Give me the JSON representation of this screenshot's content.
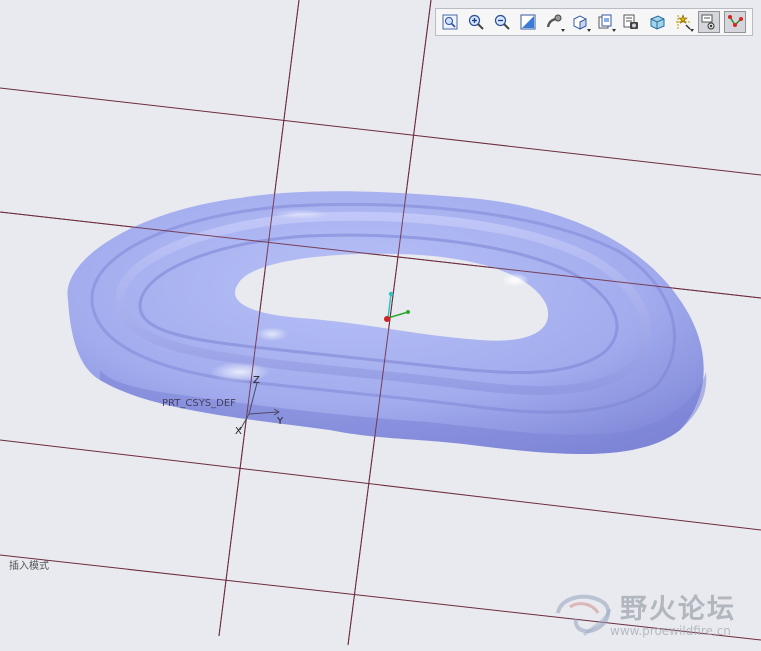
{
  "window": {
    "background": "#e8eaef"
  },
  "toolbar": {
    "buttons": [
      {
        "name": "refit-button",
        "icon": "zoom-fit-icon"
      },
      {
        "name": "zoom-in-button",
        "icon": "zoom-in-icon"
      },
      {
        "name": "zoom-out-button",
        "icon": "zoom-out-icon"
      },
      {
        "name": "repaint-button",
        "icon": "repaint-icon"
      },
      {
        "name": "spin-center-button",
        "icon": "spin-center-icon"
      },
      {
        "name": "display-style-button",
        "icon": "shaded-cube-icon"
      },
      {
        "name": "saved-views-button",
        "icon": "saved-views-icon"
      },
      {
        "name": "view-manager-button",
        "icon": "view-manager-icon"
      },
      {
        "name": "orientation-button",
        "icon": "orient-cube-icon"
      },
      {
        "name": "datum-display-button",
        "icon": "datum-display-icon"
      },
      {
        "name": "annotation-display-button",
        "icon": "annotation-display-icon"
      },
      {
        "name": "sketch-display-button",
        "icon": "sketch-display-icon"
      }
    ]
  },
  "model": {
    "color": "#a6b0ef",
    "highlight": "#f1f3ff",
    "shadow": "#6f76c9"
  },
  "datum": {
    "line_color": "#6d2b3d"
  },
  "csys": {
    "name": "PRT_CSYS_DEF",
    "z_label": "Z",
    "y_label": "Y",
    "x_label": "X"
  },
  "status": {
    "insert_mode": "插入模式"
  },
  "watermark": {
    "title": "野火论坛",
    "url": "www.proewildfire.cn"
  }
}
